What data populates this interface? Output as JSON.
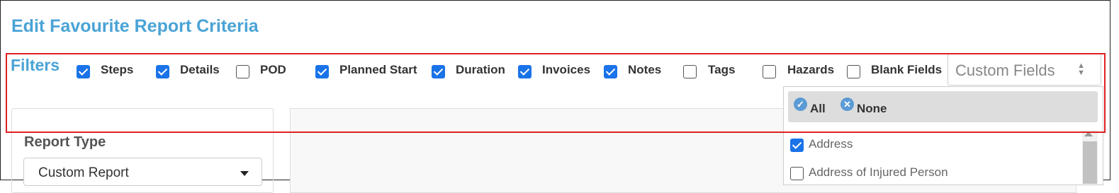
{
  "page": {
    "title": "Edit Favourite Report Criteria"
  },
  "filters": {
    "label": "Filters",
    "items": [
      {
        "label": "Steps",
        "checked": true
      },
      {
        "label": "Details",
        "checked": true
      },
      {
        "label": "POD",
        "checked": false
      },
      {
        "label": "Planned Start",
        "checked": true
      },
      {
        "label": "Duration",
        "checked": true
      },
      {
        "label": "Invoices",
        "checked": true
      },
      {
        "label": "Notes",
        "checked": true
      },
      {
        "label": "Tags",
        "checked": false
      },
      {
        "label": "Hazards",
        "checked": false
      },
      {
        "label": "Blank Fields",
        "checked": false
      }
    ]
  },
  "custom_fields": {
    "placeholder": "Custom Fields",
    "all_label": "All",
    "none_label": "None",
    "options": [
      {
        "label": "Address",
        "checked": true
      },
      {
        "label": "Address of Injured Person",
        "checked": false
      }
    ]
  },
  "report_type": {
    "label": "Report Type",
    "value": "Custom Report"
  },
  "colors": {
    "title_blue": "#4aa3d6",
    "checkbox_blue": "#1a73e8",
    "highlight_red": "#e02020"
  }
}
